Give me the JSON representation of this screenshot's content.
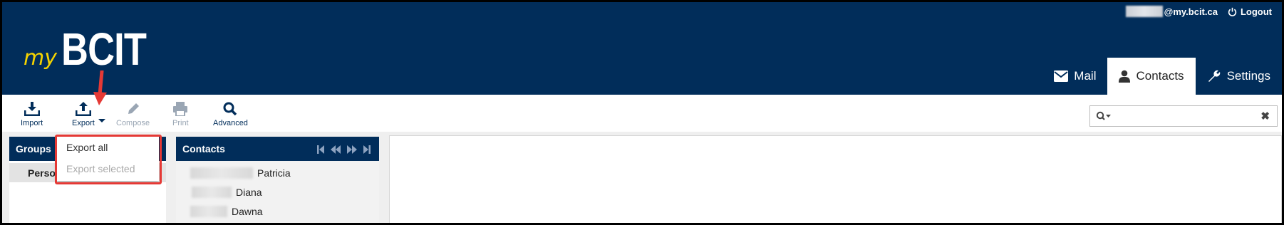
{
  "header": {
    "logo_my": "my",
    "logo_bcit": "BCIT",
    "email_domain": "@my.bcit.ca",
    "logout_label": "Logout"
  },
  "tabs": [
    {
      "label": "Mail",
      "icon": "envelope-icon",
      "active": false
    },
    {
      "label": "Contacts",
      "icon": "person-icon",
      "active": true
    },
    {
      "label": "Settings",
      "icon": "wrench-icon",
      "active": false
    }
  ],
  "toolbar": {
    "import_label": "Import",
    "export_label": "Export",
    "compose_label": "Compose",
    "print_label": "Print",
    "advanced_label": "Advanced"
  },
  "search": {
    "clear_symbol": "✖"
  },
  "groups": {
    "header": "Groups",
    "items": [
      "Perso"
    ]
  },
  "contacts": {
    "header": "Contacts",
    "items": [
      "Patricia",
      "Diana",
      "Dawna"
    ]
  },
  "export_menu": {
    "export_all": "Export all",
    "export_selected": "Export selected"
  },
  "colors": {
    "brand_navy": "#012d5a",
    "logo_yellow": "#f4d300",
    "annotation_red": "#e53935"
  }
}
